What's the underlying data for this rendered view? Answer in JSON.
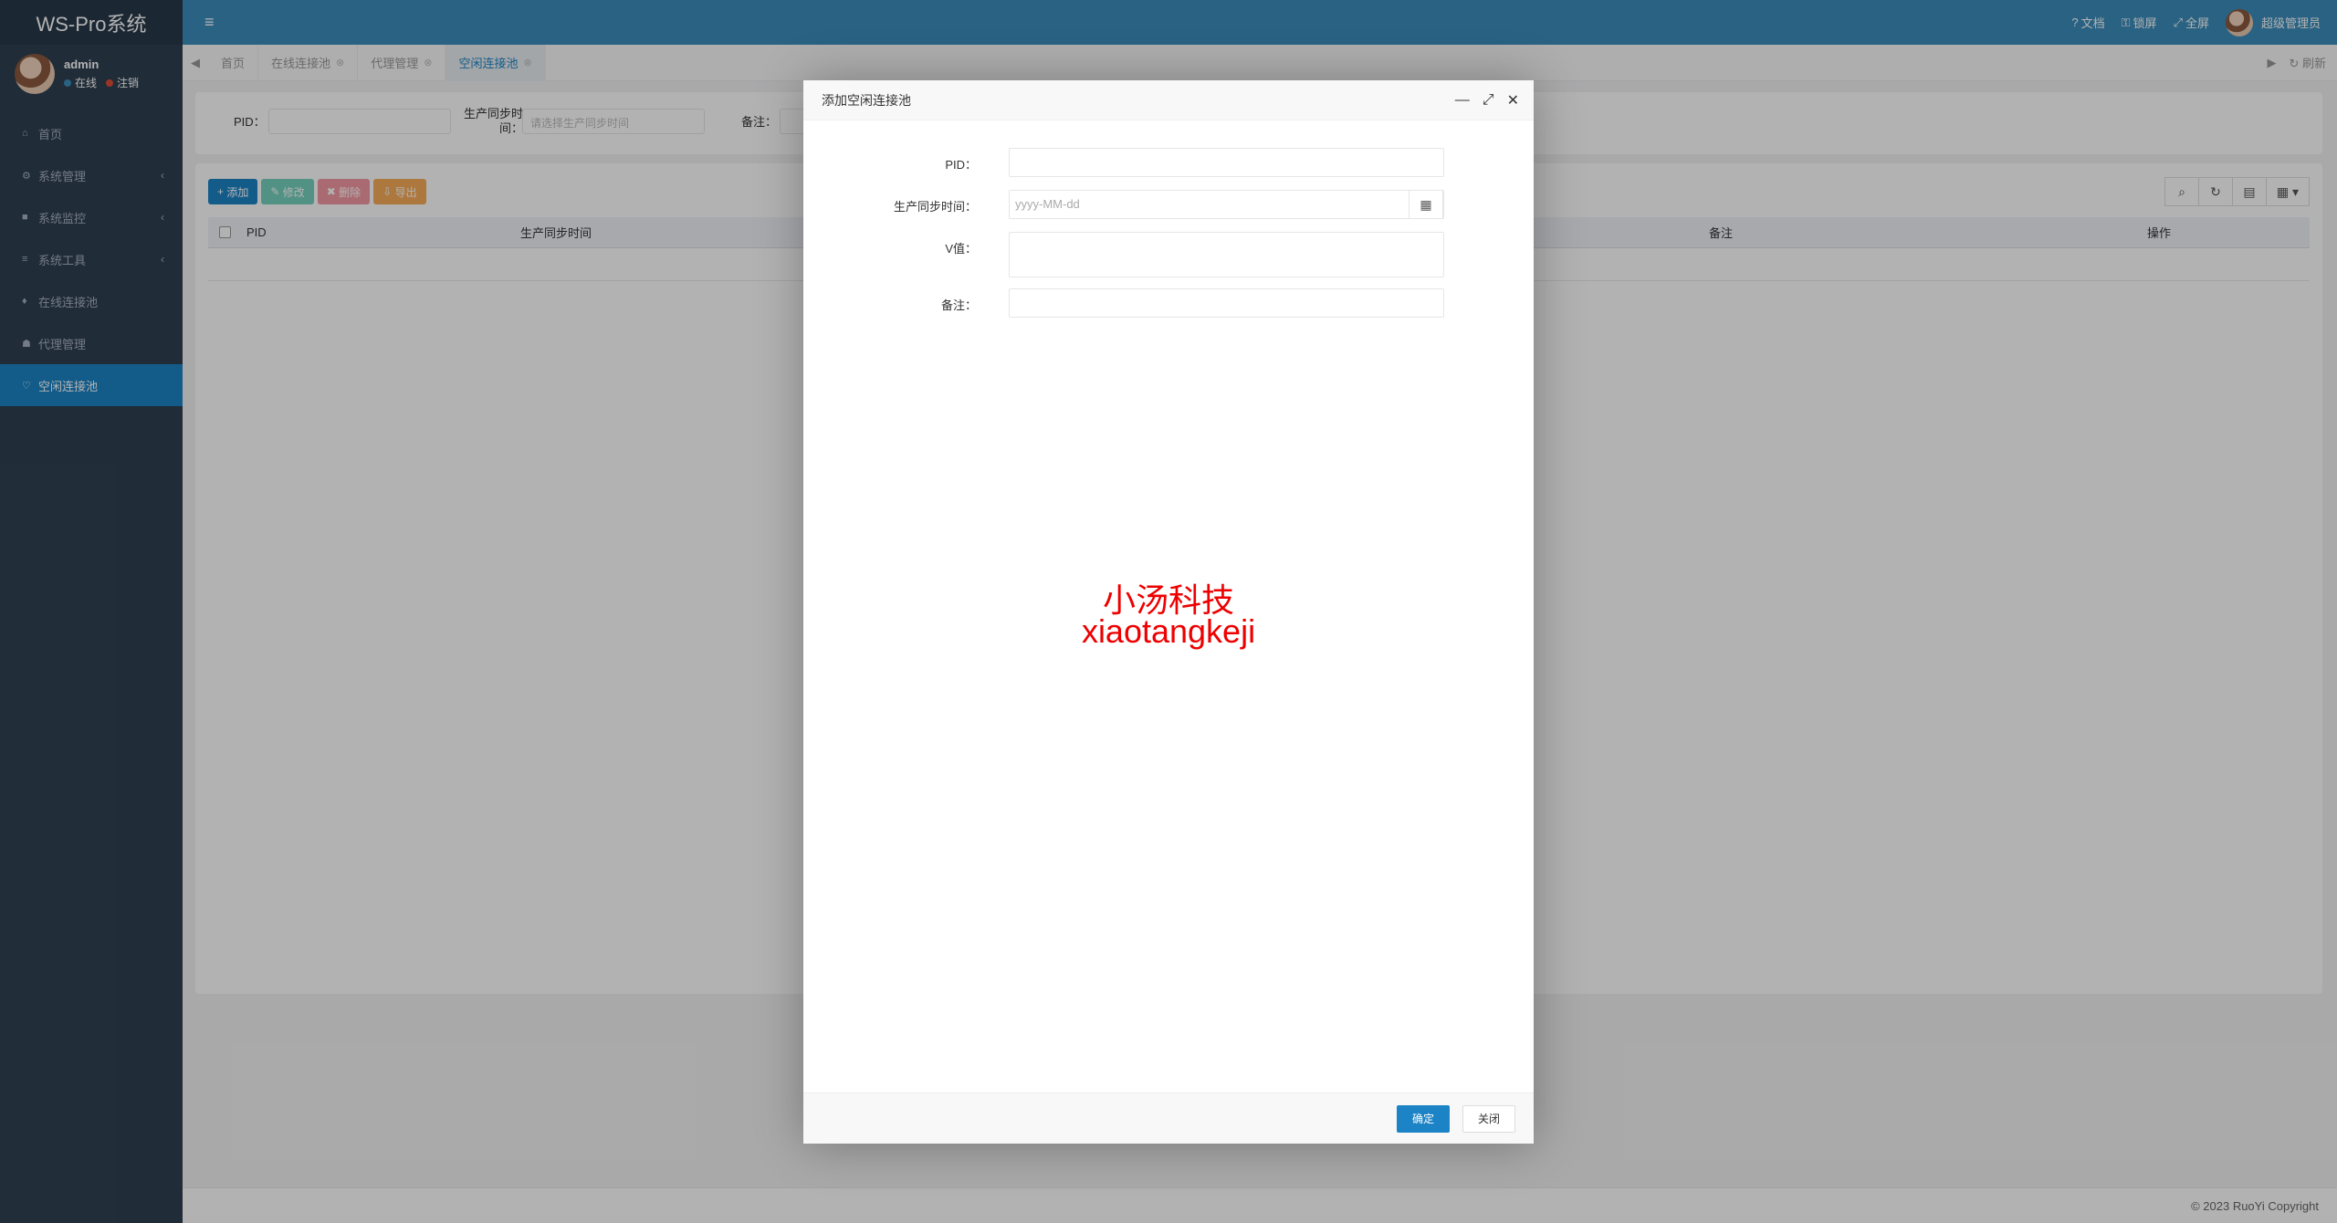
{
  "app": {
    "brand": "WS-Pro系统",
    "menu_toggle_icon": "hamburger-icon"
  },
  "user": {
    "name": "admin",
    "status_online": "在线",
    "logout": "注销"
  },
  "sidebar": {
    "items": [
      {
        "label": "首页",
        "icon": "home-icon"
      },
      {
        "label": "系统管理",
        "icon": "gear-icon"
      },
      {
        "label": "系统监控",
        "icon": "video-icon"
      },
      {
        "label": "系统工具",
        "icon": "bars-icon"
      },
      {
        "label": "在线连接池",
        "icon": "diamond-icon"
      },
      {
        "label": "代理管理",
        "icon": "users-icon"
      },
      {
        "label": "空闲连接池",
        "icon": "heart-icon"
      }
    ]
  },
  "topbar": {
    "docs": "文档",
    "lock": "锁屏",
    "fullscreen": "全屏",
    "role": "超级管理员"
  },
  "tabs": {
    "items": [
      "首页",
      "在线连接池",
      "代理管理",
      "空闲连接池"
    ],
    "refresh": "刷新"
  },
  "search": {
    "pid_label": "PID：",
    "sync_label_line1": "生产同步时",
    "sync_label_line2": "间：",
    "sync_placeholder": "请选择生产同步时间",
    "remark_label": "备注："
  },
  "toolbar": {
    "add": "添加",
    "edit": "修改",
    "delete": "删除",
    "export": "导出"
  },
  "table": {
    "columns": [
      "PID",
      "生产同步时间",
      "备注",
      "操作"
    ]
  },
  "modal": {
    "title": "添加空闲连接池",
    "pid_label": "PID：",
    "sync_label": "生产同步时间：",
    "date_placeholder": "yyyy-MM-dd",
    "v_label": "V值：",
    "remark_label": "备注：",
    "watermark_cn": "小汤科技",
    "watermark_en": "xiaotangkeji",
    "ok": "确定",
    "close": "关闭"
  },
  "footer": {
    "copyright": "© 2023 RuoYi Copyright"
  },
  "colors": {
    "accent": "#1c84c6",
    "sidebar_bg": "#2f4050",
    "topbar_bg": "#3c8dbc",
    "watermark": "#ee0000"
  }
}
